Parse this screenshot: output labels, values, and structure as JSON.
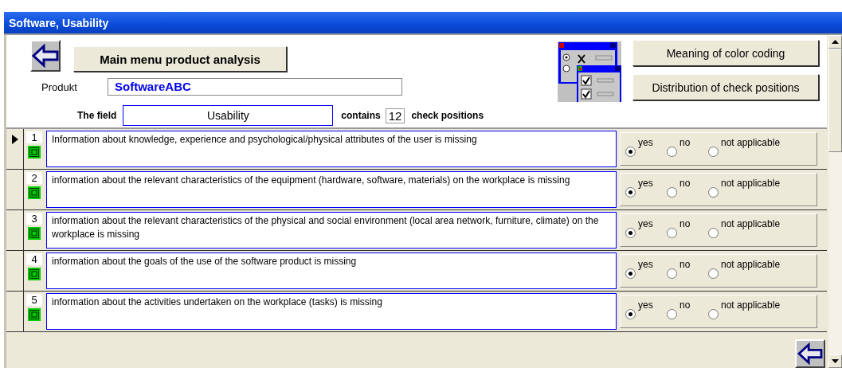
{
  "window": {
    "title": "Software, Usability"
  },
  "header": {
    "main_menu_button": "Main menu product analysis",
    "product_label": "Produkt",
    "product_value": "SoftwareABC",
    "field_label": "The field",
    "field_value": "Usability",
    "contains_label": "contains",
    "count": "12",
    "count_suffix": "check positions",
    "buttons": [
      "Meaning of color coding",
      "Distribution of check positions"
    ]
  },
  "rows": [
    {
      "number": "1",
      "current": true,
      "color": "#00cc00",
      "text": "Information about knowledge, experience and psychological/physical attributes of the user is missing",
      "options": [
        {
          "label": "yes",
          "selected": true
        },
        {
          "label": "no",
          "selected": false
        },
        {
          "label": "not applicable",
          "selected": false
        }
      ]
    },
    {
      "number": "2",
      "current": false,
      "color": "#00cc00",
      "text": "information about the relevant characteristics of the equipment (hardware, software, materials) on the workplace is missing",
      "options": [
        {
          "label": "yes",
          "selected": true
        },
        {
          "label": "no",
          "selected": false
        },
        {
          "label": "not applicable",
          "selected": false
        }
      ]
    },
    {
      "number": "3",
      "current": false,
      "color": "#00cc00",
      "text": "information about the relevant characteristics of the physical and social environment (local area network, furniture, climate) on the workplace is missing",
      "options": [
        {
          "label": "yes",
          "selected": true
        },
        {
          "label": "no",
          "selected": false
        },
        {
          "label": "not applicable",
          "selected": false
        }
      ]
    },
    {
      "number": "4",
      "current": false,
      "color": "#00cc00",
      "text": "information about the goals of the use of the software product is missing",
      "options": [
        {
          "label": "yes",
          "selected": true
        },
        {
          "label": "no",
          "selected": false
        },
        {
          "label": "not applicable",
          "selected": false
        }
      ]
    },
    {
      "number": "5",
      "current": false,
      "color": "#00cc00",
      "text": "information about the activities undertaken on the workplace (tasks) is missing",
      "options": [
        {
          "label": "yes",
          "selected": true
        },
        {
          "label": "no",
          "selected": false
        },
        {
          "label": "not applicable",
          "selected": false
        }
      ]
    }
  ]
}
